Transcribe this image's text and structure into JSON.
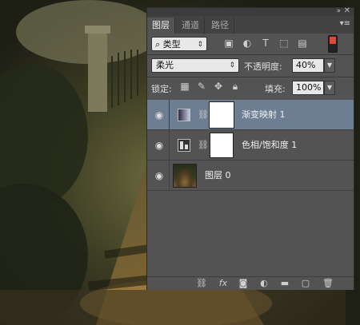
{
  "panel": {
    "tabs": [
      {
        "label": "图层",
        "active": true
      },
      {
        "label": "通道",
        "active": false
      },
      {
        "label": "路径",
        "active": false
      }
    ],
    "filter": {
      "label": "类型"
    },
    "blend_mode": "柔光",
    "opacity_label": "不透明度:",
    "opacity_value": "40%",
    "lock_label": "锁定:",
    "fill_label": "填充:",
    "fill_value": "100%",
    "layers": [
      {
        "name": "渐变映射 1",
        "type": "gradient-map-adjustment",
        "selected": true,
        "visible": true
      },
      {
        "name": "色相/饱和度 1",
        "type": "hue-saturation-adjustment",
        "selected": false,
        "visible": true
      },
      {
        "name": "图层 0",
        "type": "image",
        "selected": false,
        "visible": true
      }
    ],
    "bottom_icons": [
      "link-layers-icon",
      "fx-icon",
      "add-mask-icon",
      "new-adjustment-icon",
      "group-folder-icon",
      "new-layer-icon",
      "trash-icon"
    ],
    "fx_text": "fx",
    "selected_color": "#6d7d92",
    "filter_toggle_color": "#e04a3a"
  }
}
